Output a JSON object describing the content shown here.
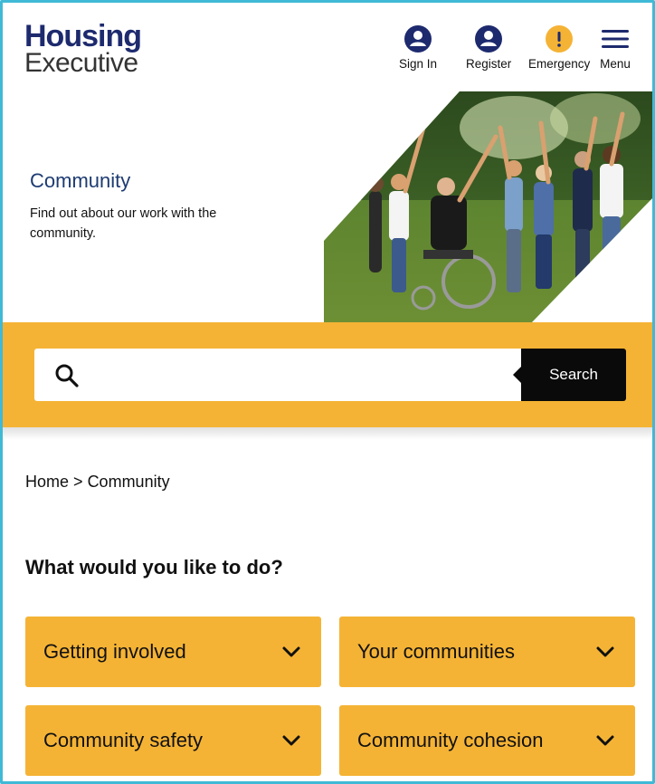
{
  "header": {
    "logo_top": "Housing",
    "logo_bottom": "Executive",
    "nav": {
      "sign_in": "Sign In",
      "register": "Register",
      "emergency": "Emergency",
      "menu": "Menu"
    }
  },
  "hero": {
    "title": "Community",
    "description": "Find out about our work with the community."
  },
  "search": {
    "placeholder": "",
    "button_label": "Search"
  },
  "breadcrumb": {
    "home": "Home",
    "separator": ">",
    "current": "Community"
  },
  "main": {
    "heading": "What would you like to do?",
    "cards": [
      {
        "label": "Getting involved"
      },
      {
        "label": "Your communities"
      },
      {
        "label": "Community safety"
      },
      {
        "label": "Community cohesion"
      }
    ]
  },
  "colors": {
    "brand_navy": "#1d2a6e",
    "accent_yellow": "#f5b335",
    "frame_cyan": "#3fb9d6",
    "button_black": "#0a0a0a"
  },
  "icons": {
    "sign_in": "user-circle-icon",
    "register": "user-circle-icon",
    "emergency": "alert-icon",
    "menu": "hamburger-icon",
    "search": "search-icon",
    "card_toggle": "chevron-down-icon"
  }
}
